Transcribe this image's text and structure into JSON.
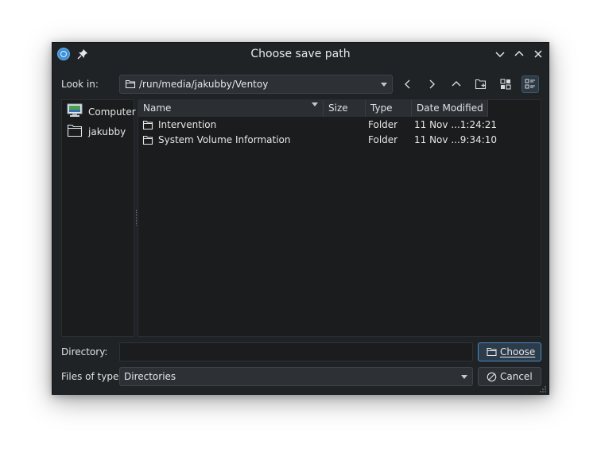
{
  "window": {
    "title": "Choose save path"
  },
  "toolbar": {
    "look_in_label": "Look in:",
    "look_in_path": "/run/media/jakubby/Ventoy"
  },
  "places": [
    {
      "label": "Computer",
      "icon": "computer-icon"
    },
    {
      "label": "jakubby",
      "icon": "folder-icon"
    }
  ],
  "files": {
    "columns": [
      "Name",
      "Size",
      "Type",
      "Date Modified"
    ],
    "rows": [
      {
        "name": "Intervention",
        "size": "",
        "type": "Folder",
        "modified": "11 Nov ...1:24:21"
      },
      {
        "name": "System Volume Information",
        "size": "",
        "type": "Folder",
        "modified": "11 Nov ...9:34:10"
      }
    ]
  },
  "footer": {
    "directory_label": "Directory:",
    "directory_value": "",
    "files_of_type_label": "Files of type:",
    "files_of_type_value": "Directories",
    "choose_label": "Choose",
    "cancel_label": "Cancel"
  },
  "colors": {
    "background": "#202326",
    "view_background": "#1a1c1e",
    "accent": "#4a88c4"
  }
}
